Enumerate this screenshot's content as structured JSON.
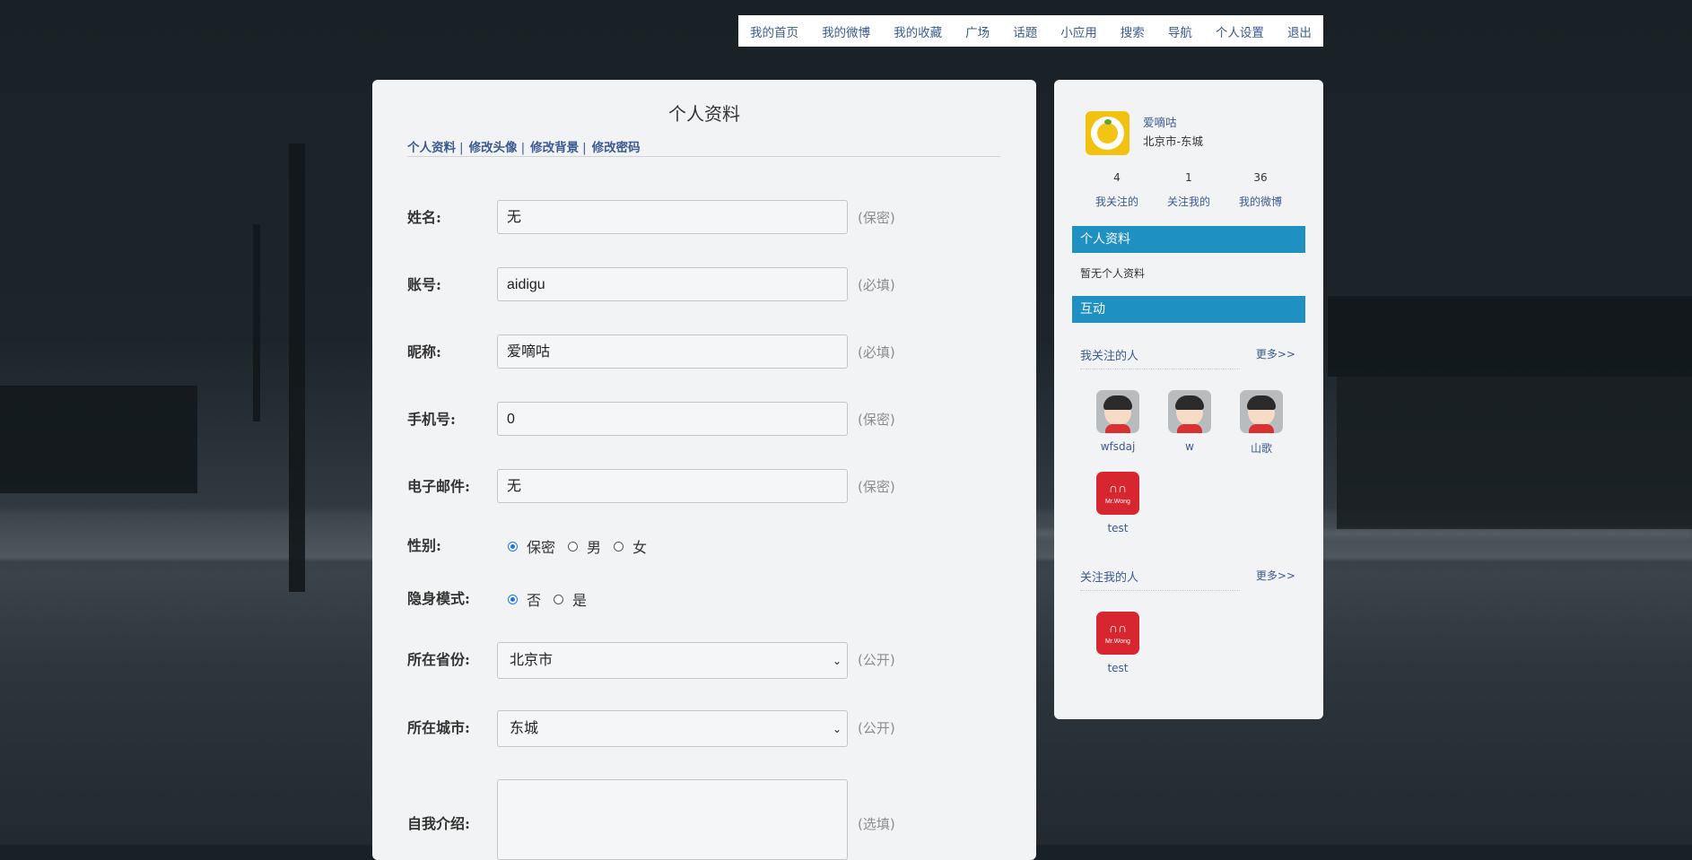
{
  "topnav": [
    "我的首页",
    "我的微博",
    "我的收藏",
    "广场",
    "话题",
    "小应用",
    "搜索",
    "导航",
    "个人设置",
    "退出"
  ],
  "main": {
    "title": "个人资料",
    "subnav": [
      "个人资料",
      "修改头像",
      "修改背景",
      "修改密码"
    ],
    "subnav_sep": "|",
    "fields": {
      "name": {
        "label": "姓名:",
        "value": "无",
        "note": "(保密)"
      },
      "account": {
        "label": "账号:",
        "value": "aidigu",
        "note": "(必填)"
      },
      "nick": {
        "label": "昵称:",
        "value": "爱嘀咕",
        "note": "(必填)"
      },
      "phone": {
        "label": "手机号:",
        "value": "0",
        "note": "(保密)"
      },
      "email": {
        "label": "电子邮件:",
        "value": "无",
        "note": "(保密)"
      },
      "province": {
        "label": "所在省份:",
        "value": "北京市",
        "note": "(公开)"
      },
      "city": {
        "label": "所在城市:",
        "value": "东城",
        "note": "(公开)"
      },
      "intro": {
        "label": "自我介绍:",
        "value": "",
        "note": "(选填)"
      }
    },
    "gender": {
      "label": "性别:",
      "options": [
        "保密",
        "男",
        "女"
      ],
      "selected": "保密"
    },
    "invisible": {
      "label": "隐身模式:",
      "options": [
        "否",
        "是"
      ],
      "selected": "否"
    }
  },
  "side": {
    "username": "爱嘀咕",
    "location": "北京市-东城",
    "stats": [
      {
        "num": "4",
        "label": "我关注的"
      },
      {
        "num": "1",
        "label": "关注我的"
      },
      {
        "num": "36",
        "label": "我的微博"
      }
    ],
    "profile_bar": "个人资料",
    "profile_text": "暂无个人资料",
    "interact_bar": "互动",
    "following": {
      "title": "我关注的人",
      "more": "更多>>",
      "people": [
        "wfsdaj",
        "w",
        "山歌",
        "test"
      ]
    },
    "followers": {
      "title": "关注我的人",
      "more": "更多>>",
      "people": [
        "test"
      ]
    },
    "badge_text": "Mr.Wong",
    "accent": "#1e90c2",
    "link_color": "#3b5a8f"
  }
}
